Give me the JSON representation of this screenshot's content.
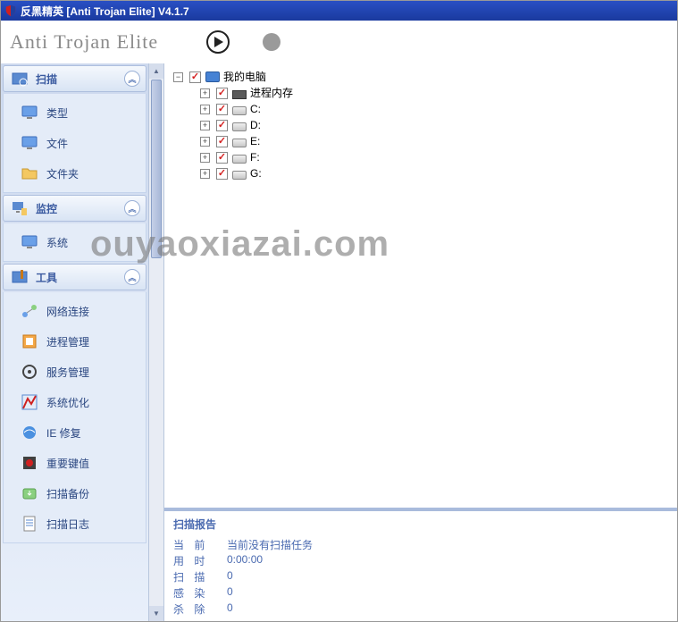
{
  "title": "反黑精英 [Anti Trojan Elite] V4.1.7",
  "logo": "Anti Trojan Elite",
  "watermark": "ouyaoxiazai.com",
  "sidebar": {
    "sections": [
      {
        "label": "扫描",
        "items": [
          {
            "label": "类型",
            "icon": "monitor"
          },
          {
            "label": "文件",
            "icon": "monitor"
          },
          {
            "label": "文件夹",
            "icon": "folder"
          }
        ]
      },
      {
        "label": "监控",
        "items": [
          {
            "label": "系统",
            "icon": "monitor"
          }
        ]
      },
      {
        "label": "工具",
        "items": [
          {
            "label": "网络连接",
            "icon": "net"
          },
          {
            "label": "进程管理",
            "icon": "proc"
          },
          {
            "label": "服务管理",
            "icon": "svc"
          },
          {
            "label": "系统优化",
            "icon": "opt"
          },
          {
            "label": "IE 修复",
            "icon": "ie"
          },
          {
            "label": "重要键值",
            "icon": "reg"
          },
          {
            "label": "扫描备份",
            "icon": "backup"
          },
          {
            "label": "扫描日志",
            "icon": "log"
          }
        ]
      }
    ]
  },
  "tree": {
    "root": {
      "label": "我的电脑",
      "checked": true
    },
    "children": [
      {
        "label": "进程内存",
        "checked": true,
        "icon": "mem"
      },
      {
        "label": "C:",
        "checked": true,
        "icon": "drive"
      },
      {
        "label": "D:",
        "checked": true,
        "icon": "drive"
      },
      {
        "label": "E:",
        "checked": true,
        "icon": "drive"
      },
      {
        "label": "F:",
        "checked": true,
        "icon": "drive"
      },
      {
        "label": "G:",
        "checked": true,
        "icon": "drive"
      }
    ]
  },
  "report": {
    "title": "扫描报告",
    "rows": [
      {
        "label": "当 前",
        "value": "当前没有扫描任务"
      },
      {
        "label": "用 时",
        "value": "0:00:00"
      },
      {
        "label": "扫 描",
        "value": "0"
      },
      {
        "label": "感 染",
        "value": "0"
      },
      {
        "label": "杀 除",
        "value": "0"
      }
    ]
  }
}
